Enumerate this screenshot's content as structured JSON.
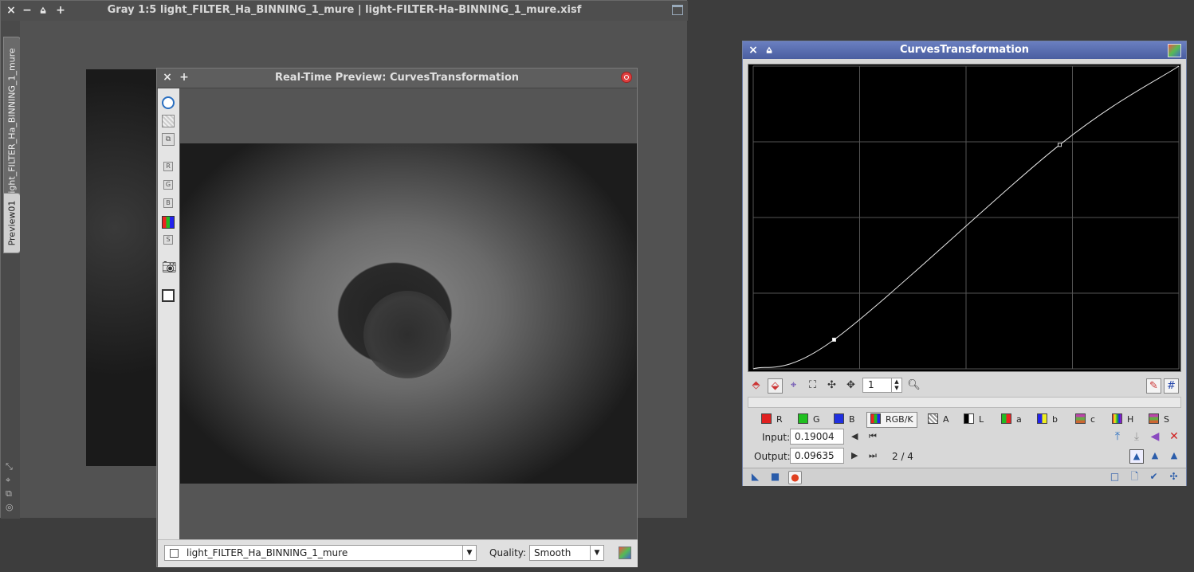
{
  "main_window": {
    "title": "Gray 1:5 light_FILTER_Ha_BINNING_1_mure | light-FILTER-Ha-BINNING_1_mure.xisf",
    "tabs": [
      "light_FILTER_Ha_BINNING_1_mure",
      "Preview01"
    ]
  },
  "preview_window": {
    "title": "Real-Time Preview: CurvesTransformation",
    "tool_letters": [
      "R",
      "G",
      "B",
      "",
      "S"
    ],
    "view_select": "light_FILTER_Ha_BINNING_1_mure",
    "quality_label": "Quality:",
    "quality_value": "Smooth"
  },
  "curves_window": {
    "title": "CurvesTransformation",
    "zoom_value": "1",
    "channels": [
      {
        "label": "R",
        "color": "#e02020"
      },
      {
        "label": "G",
        "color": "#20c020"
      },
      {
        "label": "B",
        "color": "#2030e0"
      },
      {
        "label": "RGB/K",
        "color": "#444444"
      },
      {
        "label": "A",
        "color": "#ffffff"
      },
      {
        "label": "L",
        "color": "#888888"
      },
      {
        "label": "a",
        "color": "#cc4020"
      },
      {
        "label": "b",
        "color": "#c0a020"
      },
      {
        "label": "c",
        "color": "#a050a0"
      },
      {
        "label": "H",
        "color": "#d06020"
      },
      {
        "label": "S",
        "color": "#c04040"
      }
    ],
    "input_label": "Input:",
    "input_value": "0.19004",
    "output_label": "Output:",
    "output_value": "0.09635",
    "point_counter": "2 / 4",
    "curve_points": [
      [
        0,
        0
      ],
      [
        0.19004,
        0.09635
      ],
      [
        0.72,
        0.74
      ],
      [
        1,
        1
      ]
    ]
  }
}
